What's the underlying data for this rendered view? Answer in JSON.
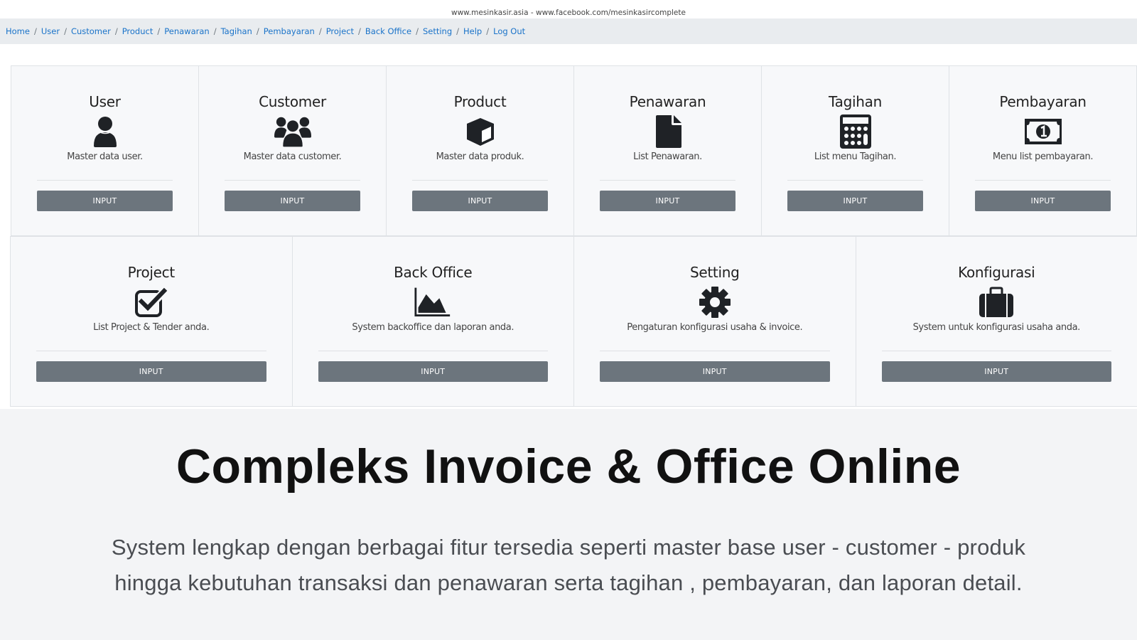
{
  "header": {
    "site_line": "www.mesinkasir.asia - www.facebook.com/mesinkasircomplete"
  },
  "breadcrumb": {
    "items": [
      {
        "label": "Home"
      },
      {
        "label": "User"
      },
      {
        "label": "Customer"
      },
      {
        "label": "Product"
      },
      {
        "label": "Penawaran"
      },
      {
        "label": "Tagihan"
      },
      {
        "label": "Pembayaran"
      },
      {
        "label": "Project"
      },
      {
        "label": "Back Office"
      },
      {
        "label": "Setting"
      },
      {
        "label": "Help"
      },
      {
        "label": "Log Out"
      }
    ],
    "separator": "/"
  },
  "cards_row1": [
    {
      "title": "User",
      "icon": "user-icon",
      "desc": "Master data user.",
      "button": "INPUT"
    },
    {
      "title": "Customer",
      "icon": "users-icon",
      "desc": "Master data customer.",
      "button": "INPUT"
    },
    {
      "title": "Product",
      "icon": "cube-icon",
      "desc": "Master data produk.",
      "button": "INPUT"
    },
    {
      "title": "Penawaran",
      "icon": "file-icon",
      "desc": "List Penawaran.",
      "button": "INPUT"
    },
    {
      "title": "Tagihan",
      "icon": "calculator-icon",
      "desc": "List menu Tagihan.",
      "button": "INPUT"
    },
    {
      "title": "Pembayaran",
      "icon": "money-bill-icon",
      "desc": "Menu list pembayaran.",
      "button": "INPUT"
    }
  ],
  "cards_row2": [
    {
      "title": "Project",
      "icon": "check-square-icon",
      "desc": "List Project & Tender anda.",
      "button": "INPUT"
    },
    {
      "title": "Back Office",
      "icon": "area-chart-icon",
      "desc": "System backoffice dan laporan anda.",
      "button": "INPUT"
    },
    {
      "title": "Setting",
      "icon": "gear-icon",
      "desc": "Pengaturan konfigurasi usaha & invoice.",
      "button": "INPUT"
    },
    {
      "title": "Konfigurasi",
      "icon": "briefcase-icon",
      "desc": "System untuk konfigurasi usaha anda.",
      "button": "INPUT"
    }
  ],
  "hero": {
    "title": "Compleks Invoice & Office Online",
    "text_line1": "System lengkap dengan berbagai fitur tersedia seperti master base user - customer - produk",
    "text_line2": "hingga kebutuhan transaksi dan penawaran serta tagihan , pembayaran, dan laporan detail."
  },
  "colors": {
    "link": "#1a73c9",
    "button_bg": "#6c757d",
    "card_bg": "#f7f8fa",
    "navbar_bg": "#e9ecef",
    "hero_bg": "#f3f4f6"
  }
}
